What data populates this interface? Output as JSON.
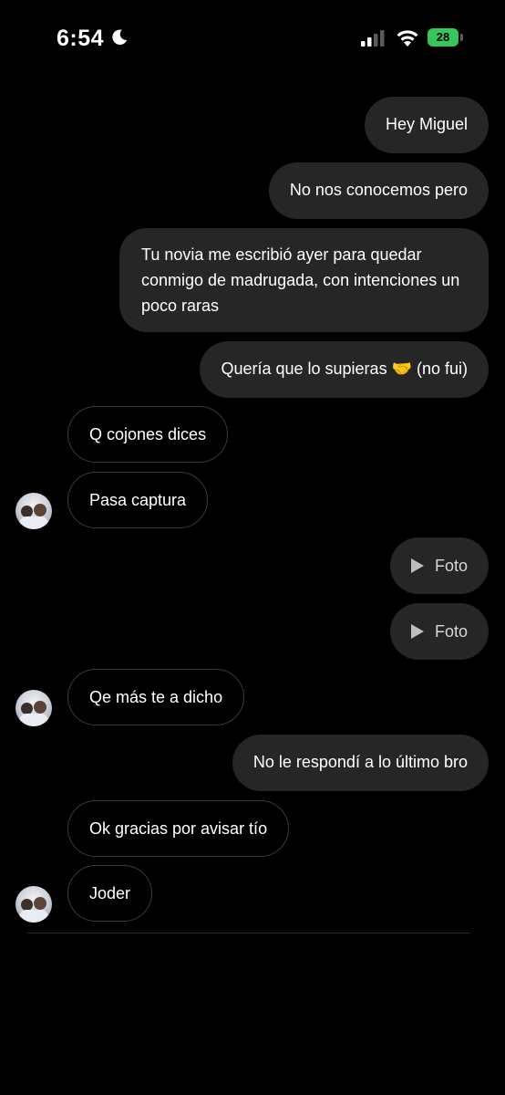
{
  "status_bar": {
    "time": "6:54",
    "battery": "28"
  },
  "messages": [
    {
      "from": "me",
      "text": "Hey Miguel"
    },
    {
      "from": "me",
      "text": "No nos conocemos pero"
    },
    {
      "from": "me",
      "text": "Tu novia me escribió ayer para quedar conmigo de madrugada, con intenciones un poco raras"
    },
    {
      "from": "me",
      "text": "Quería que lo supieras 🤝 (no fui)"
    },
    {
      "from": "them",
      "text": "Q cojones dices"
    },
    {
      "from": "them",
      "text": "Pasa captura"
    },
    {
      "from": "me",
      "text": "Foto"
    },
    {
      "from": "me",
      "text": "Foto"
    },
    {
      "from": "them",
      "text": "Qe más te a dicho"
    },
    {
      "from": "me",
      "text": "No le respondí a lo último bro"
    },
    {
      "from": "them",
      "text": "Ok gracias por avisar tío"
    },
    {
      "from": "them",
      "text": "Joder"
    }
  ],
  "icons": {
    "moon": "moon-icon",
    "signal": "cellular-signal-icon",
    "wifi": "wifi-icon",
    "battery": "battery-icon",
    "play": "play-icon",
    "avatar": "contact-avatar"
  },
  "colors": {
    "background": "#000000",
    "sent_bubble": "#262626",
    "received_border": "#3a3a3a",
    "battery": "#34c759"
  }
}
